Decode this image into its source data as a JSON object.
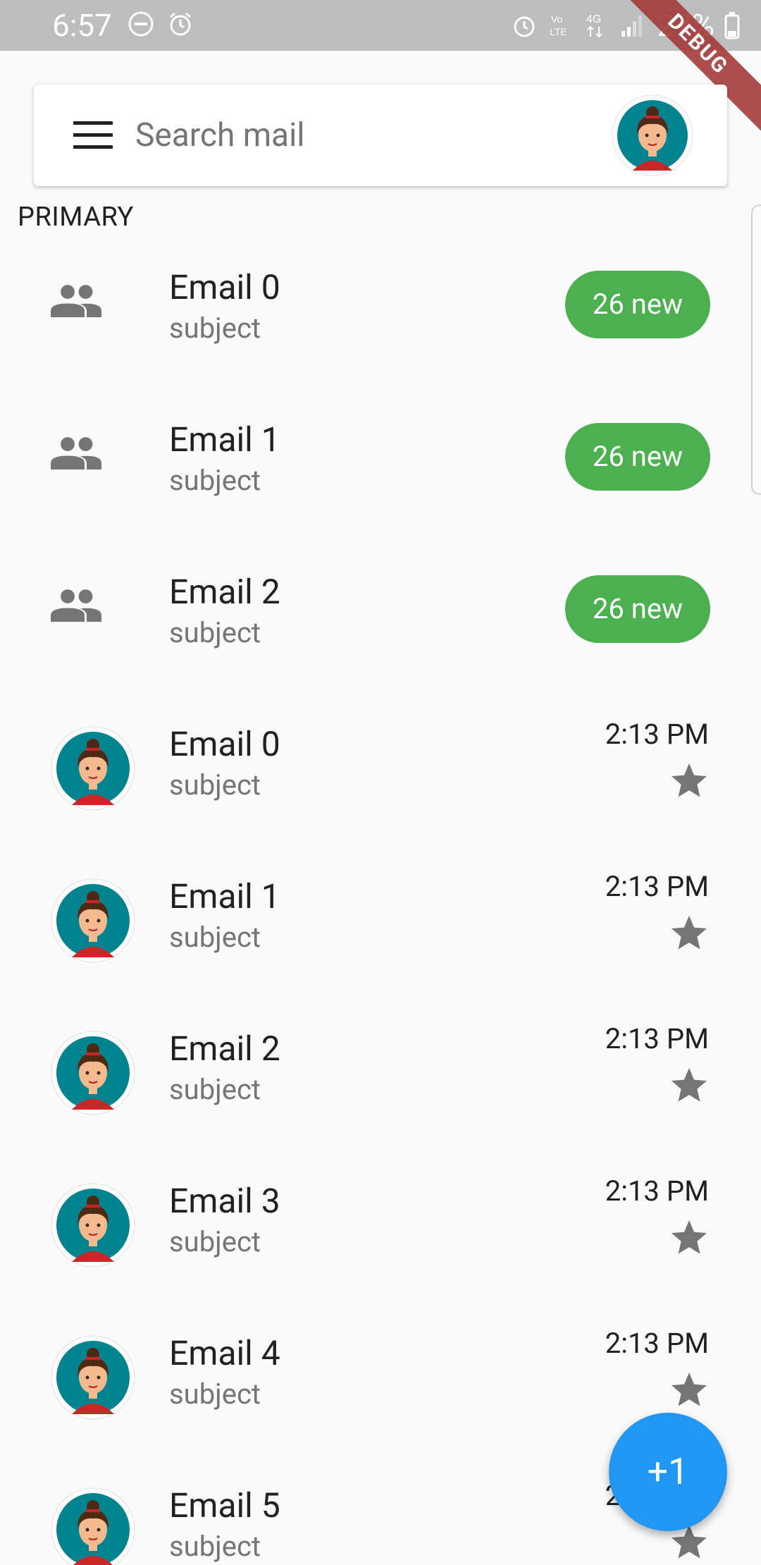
{
  "status_bar": {
    "time": "6:57",
    "battery": "27%",
    "debug_label": "DEBUG"
  },
  "search": {
    "placeholder": "Search mail"
  },
  "section": {
    "title": "PRIMARY"
  },
  "groups": [
    {
      "title": "Email 0",
      "subtitle": "subject",
      "badge": "26 new"
    },
    {
      "title": "Email 1",
      "subtitle": "subject",
      "badge": "26 new"
    },
    {
      "title": "Email 2",
      "subtitle": "subject",
      "badge": "26 new"
    }
  ],
  "emails": [
    {
      "title": "Email 0",
      "subtitle": "subject",
      "time": "2:13 PM"
    },
    {
      "title": "Email 1",
      "subtitle": "subject",
      "time": "2:13 PM"
    },
    {
      "title": "Email 2",
      "subtitle": "subject",
      "time": "2:13 PM"
    },
    {
      "title": "Email 3",
      "subtitle": "subject",
      "time": "2:13 PM"
    },
    {
      "title": "Email 4",
      "subtitle": "subject",
      "time": "2:13 PM"
    },
    {
      "title": "Email 5",
      "subtitle": "subject",
      "time": "2:13 PM"
    }
  ],
  "fab": {
    "label": "+1"
  },
  "colors": {
    "badge": "#4caf50",
    "fab": "#2196f3",
    "avatar_bg": "#00838f"
  }
}
